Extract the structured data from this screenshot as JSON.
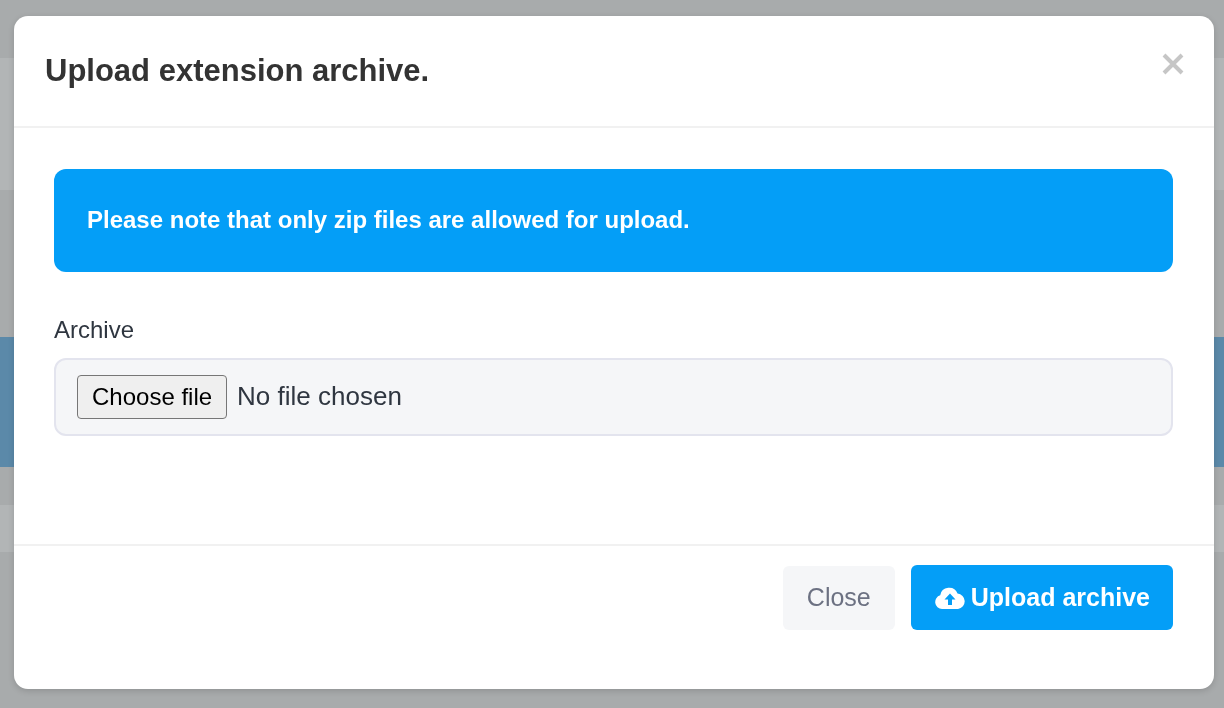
{
  "dialog": {
    "title": "Upload extension archive."
  },
  "alert": {
    "text": "Please note that only zip files are allowed for upload."
  },
  "form": {
    "label": "Archive",
    "file_button": "Choose file",
    "file_status": "No file chosen"
  },
  "buttons": [
    {
      "label": "Close",
      "kind": "secondary"
    },
    {
      "label": "Upload archive",
      "kind": "primary"
    }
  ]
}
